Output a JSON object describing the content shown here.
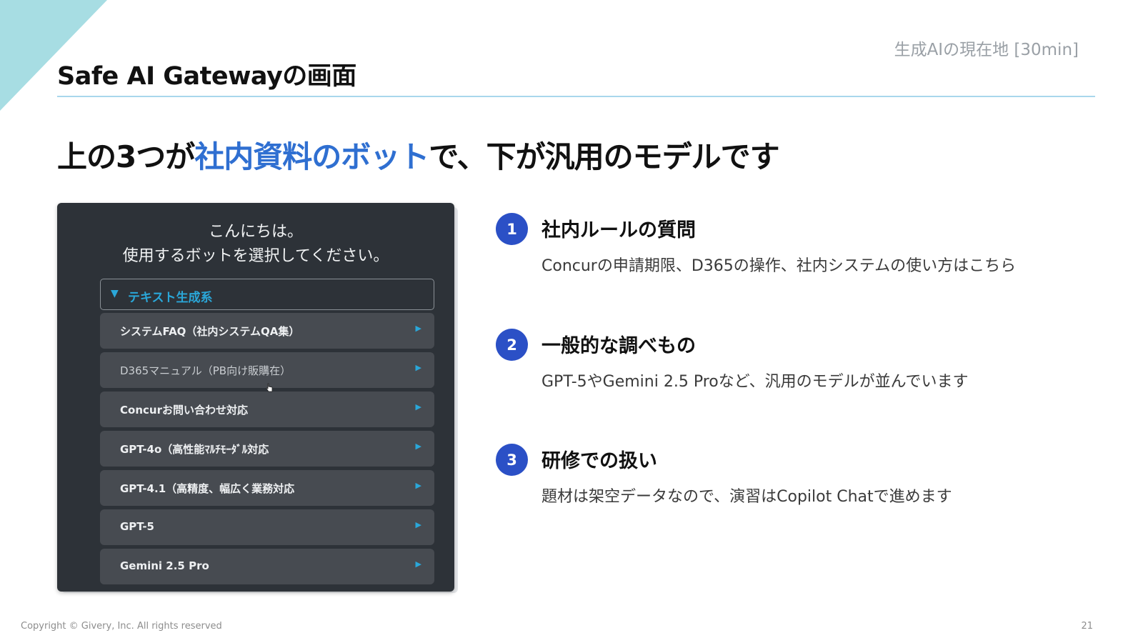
{
  "header": {
    "title": "Safe AI Gatewayの画面",
    "section": "生成AIの現在地 [30min]"
  },
  "headline": {
    "pre": "上の3つが",
    "highlight": "社内資料のボット",
    "post": "で、下が汎用のモデルです"
  },
  "screen": {
    "greeting_line1": "こんにちは。",
    "greeting_line2": "使用するボットを選択してください。",
    "category_label": "テキスト生成系",
    "bots": [
      "システムFAQ（社内システムQA集）",
      "D365マニュアル（PB向け販購在）",
      "Concurお問い合わせ対応",
      "GPT-4o（高性能ﾏﾙﾁﾓｰﾀﾞﾙ対応",
      "GPT-4.1（高精度、幅広く業務対応",
      "GPT-5",
      "Gemini 2.5 Pro"
    ]
  },
  "points": [
    {
      "number": "1",
      "title": "社内ルールの質問",
      "desc": "Concurの申請期限、D365の操作、社内システムの使い方はこちら"
    },
    {
      "number": "2",
      "title": "一般的な調べもの",
      "desc": "GPT-5やGemini 2.5 Proなど、汎用のモデルが並んでいます"
    },
    {
      "number": "3",
      "title": "研修での扱い",
      "desc": "題材は架空データなので、演習はCopilot Chatで進めます"
    }
  ],
  "footer": {
    "copyright": "Copyright © Givery, Inc. All rights reserved",
    "page": "21"
  },
  "colors": {
    "accent_blue": "#2f6fd1",
    "badge_blue": "#2b50c6",
    "corner_teal": "#a7dde3",
    "panel_bg": "#2d3238",
    "item_bg": "#474b51",
    "link_cyan": "#2aa7d9"
  },
  "icons": {
    "category": "triangle-down-icon",
    "bot_item": "triangle-right-icon",
    "cursor": "hand-pointer-icon"
  }
}
